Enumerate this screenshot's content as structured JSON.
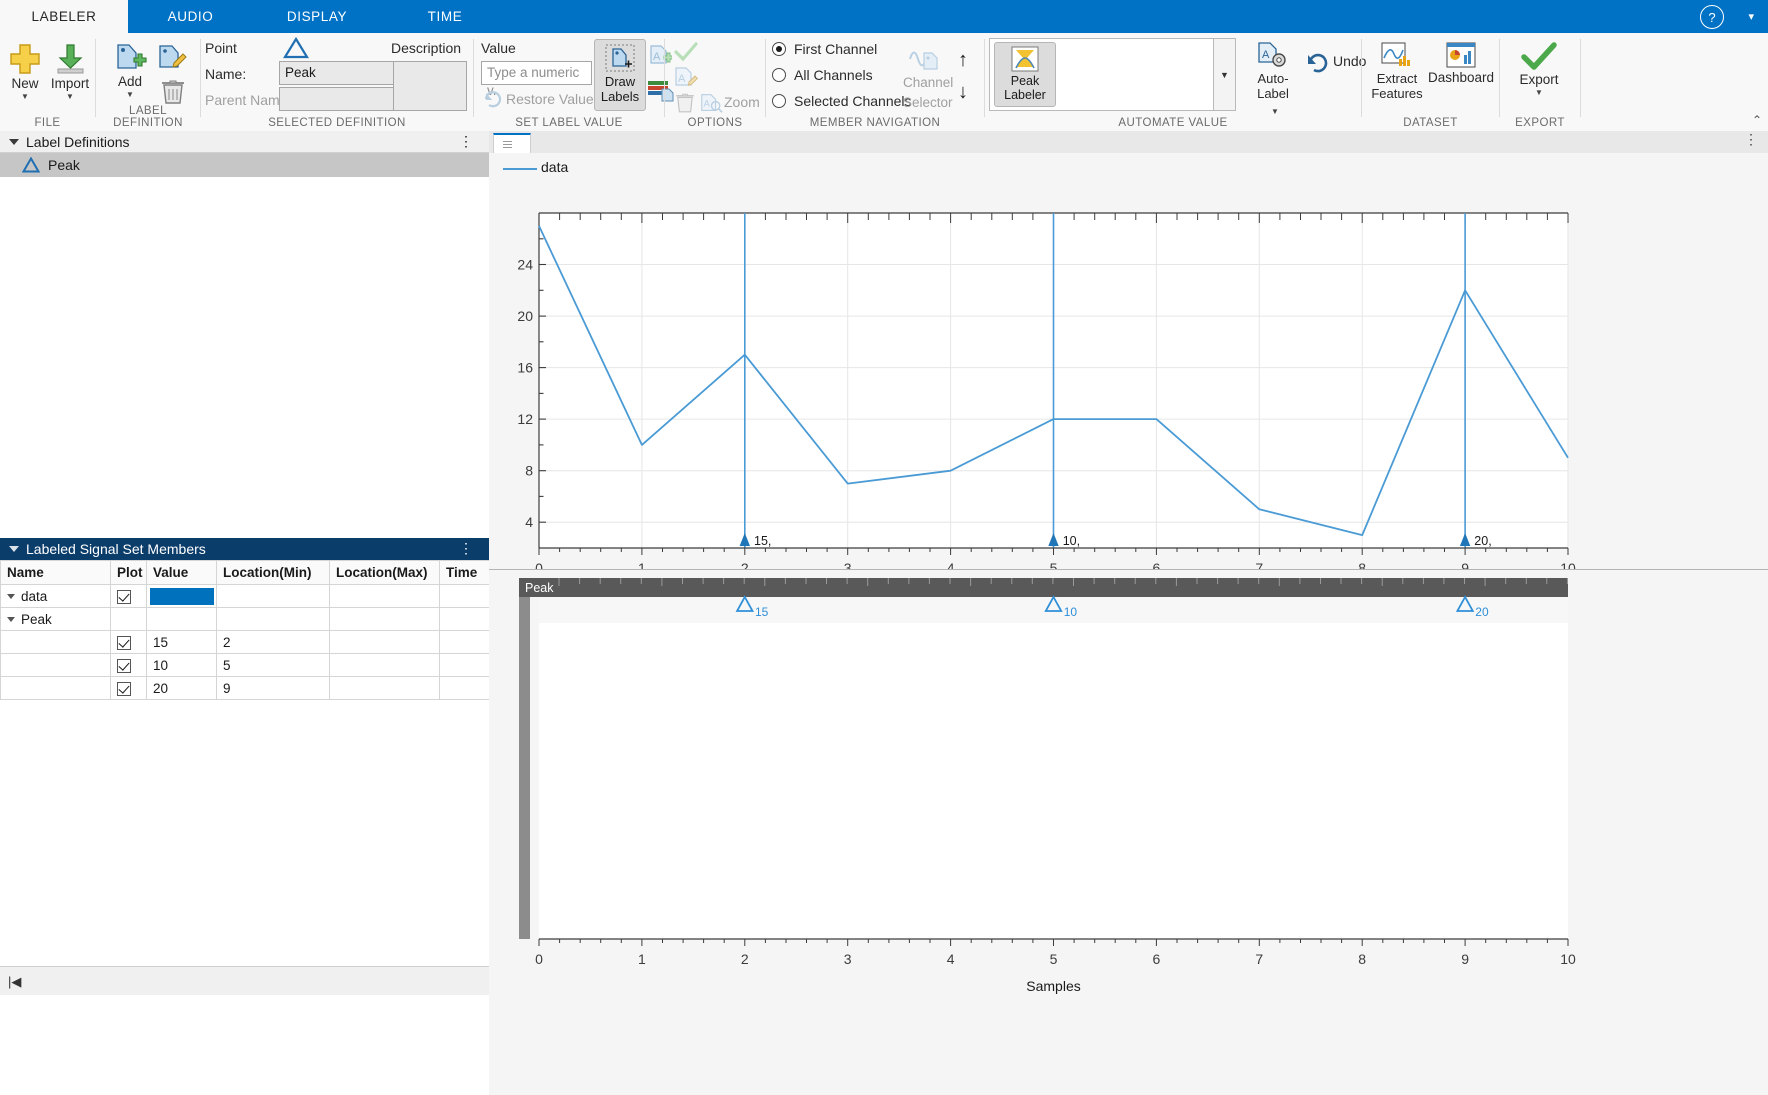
{
  "titlebar": {
    "tabs": [
      "LABELER",
      "AUDIO",
      "DISPLAY",
      "TIME"
    ],
    "active_tab": "LABELER",
    "help_icon": "help-icon",
    "chevron_icon": "chevron-down-icon"
  },
  "ribbon": {
    "groups": [
      "FILE",
      "LABEL DEFINITION",
      "SELECTED DEFINITION",
      "SET LABEL VALUE",
      "OPTIONS",
      "MEMBER NAVIGATION",
      "AUTOMATE VALUE",
      "DATASET",
      "EXPORT"
    ],
    "file": {
      "new_label": "New",
      "import_label": "Import",
      "new_icon": "plus-icon",
      "import_icon": "import-arrow-icon"
    },
    "label_definition": {
      "add_label": "Add",
      "add_icon": "tag-plus-icon",
      "edit_icon": "tag-edit-icon",
      "delete_icon": "trash-icon"
    },
    "selected_definition": {
      "point_label": "Point",
      "point_icon": "triangle-icon",
      "name_label": "Name:",
      "name_value": "Peak",
      "parent_label": "Parent Name:",
      "parent_value": "",
      "description_label": "Description",
      "description_value": ""
    },
    "set_label_value": {
      "value_label": "Value",
      "value_placeholder": "Type a numeric v.",
      "value_text": "",
      "restore_label": "Restore Value",
      "restore_icon": "undo-arrow-icon",
      "draw_labels_label": "Draw\nLabels",
      "draw_labels_line1": "Draw",
      "draw_labels_line2": "Labels",
      "draw_icon": "tag-draw-icon",
      "autolabel_icon": "tag-a-plus-icon",
      "stack_icon": "layers-icon"
    },
    "options": {
      "accept_icon": "check-icon",
      "edit_label_icon": "tag-a-edit-icon",
      "delete_icon": "trash-icon",
      "zoom_icon": "tag-a-zoom-icon",
      "zoom_label": "Zoom"
    },
    "member_navigation": {
      "radio_options": [
        "First Channel",
        "All Channels",
        "Selected Channels"
      ],
      "selected_radio": "First Channel",
      "channel_selector_line1": "Channel",
      "channel_selector_line2": "Selector",
      "channel_selector_icon": "waveform-tag-icon",
      "up_icon": "arrow-up-icon",
      "down_icon": "arrow-down-icon"
    },
    "automate_value": {
      "peak_labeler_line1": "Peak",
      "peak_labeler_line2": "Labeler",
      "peak_labeler_icon": "peak-labeler-icon",
      "list_items": [],
      "dropdown_icon": "chevron-down-icon",
      "autolabel_line1": "Auto-",
      "autolabel_line2": "Label",
      "autolabel_icon": "tag-gear-icon",
      "undo_label": "Undo",
      "undo_icon": "undo-icon"
    },
    "dataset": {
      "extract_line1": "Extract",
      "extract_line2": "Features",
      "extract_icon": "chart-features-icon",
      "dashboard_label": "Dashboard",
      "dashboard_icon": "dashboard-icon"
    },
    "export": {
      "export_label": "Export",
      "export_icon": "green-check-icon"
    },
    "collapse_icon": "collapse-ribbon-icon"
  },
  "label_definitions_panel": {
    "title": "Label Definitions",
    "kebab_icon": "more-options-icon",
    "items": [
      {
        "label": "Peak",
        "icon": "triangle-icon",
        "selected": true
      }
    ]
  },
  "members_panel": {
    "title": "Labeled Signal Set Members",
    "kebab_icon": "more-options-icon",
    "columns": [
      "Name",
      "Plot",
      "Value",
      "Location(Min)",
      "Location(Max)",
      "Time"
    ],
    "rows": [
      {
        "name": "data",
        "indent": 1,
        "expander": true,
        "plot_checked": true,
        "swatch": "#0072bd",
        "value": "",
        "loc_min": "",
        "loc_max": "",
        "time": ""
      },
      {
        "name": "Peak",
        "indent": 2,
        "expander": true,
        "plot_checked": null,
        "swatch": "",
        "value": "",
        "loc_min": "",
        "loc_max": "",
        "time": ""
      },
      {
        "name": "",
        "indent": 0,
        "expander": false,
        "plot_checked": true,
        "swatch": "",
        "value": "15",
        "loc_min": "2",
        "loc_max": "",
        "time": ""
      },
      {
        "name": "",
        "indent": 0,
        "expander": false,
        "plot_checked": true,
        "swatch": "",
        "value": "10",
        "loc_min": "5",
        "loc_max": "",
        "time": ""
      },
      {
        "name": "",
        "indent": 0,
        "expander": false,
        "plot_checked": true,
        "swatch": "",
        "value": "20",
        "loc_min": "9",
        "loc_max": "",
        "time": ""
      }
    ],
    "scroll_icon": "scroll-to-start-icon"
  },
  "plot_panel": {
    "tab_grip_icon": "drag-grip-icon",
    "kebab_icon": "more-options-icon",
    "legend": {
      "name": "data",
      "color": "#4a9bd5"
    },
    "label_track_name": "Peak"
  },
  "chart_data": [
    {
      "type": "line",
      "title": "",
      "xlabel": "Samples",
      "ylabel": "",
      "x": [
        0,
        1,
        2,
        3,
        4,
        5,
        6,
        7,
        8,
        9,
        10
      ],
      "series": [
        {
          "name": "data",
          "color": "#4a9bd5",
          "values": [
            25,
            8,
            15,
            5,
            6,
            10,
            10,
            3,
            1,
            20,
            7
          ]
        }
      ],
      "xlim": [
        0,
        10
      ],
      "ylim": [
        0,
        26
      ],
      "xticks": [
        0,
        1,
        2,
        3,
        4,
        5,
        6,
        7,
        8,
        9,
        10
      ],
      "yticks": [
        4,
        8,
        12,
        16,
        20,
        24
      ],
      "grid": true,
      "legend_position": "top-left",
      "annotations": [
        {
          "x": 2,
          "value": 15,
          "text": "15,",
          "marker": "triangle-up"
        },
        {
          "x": 5,
          "value": 10,
          "text": "10,",
          "marker": "triangle-up"
        },
        {
          "x": 9,
          "value": 20,
          "text": "20,",
          "marker": "triangle-up"
        }
      ]
    },
    {
      "type": "scatter",
      "title": "Peak",
      "xlabel": "Samples",
      "ylabel": "",
      "xlim": [
        0,
        10
      ],
      "xticks": [
        0,
        1,
        2,
        3,
        4,
        5,
        6,
        7,
        8,
        9,
        10
      ],
      "grid": false,
      "annotations": [
        {
          "x": 2,
          "text": "15",
          "marker": "triangle-up-open"
        },
        {
          "x": 5,
          "text": "10",
          "marker": "triangle-up-open"
        },
        {
          "x": 9,
          "text": "20",
          "marker": "triangle-up-open"
        }
      ]
    }
  ]
}
